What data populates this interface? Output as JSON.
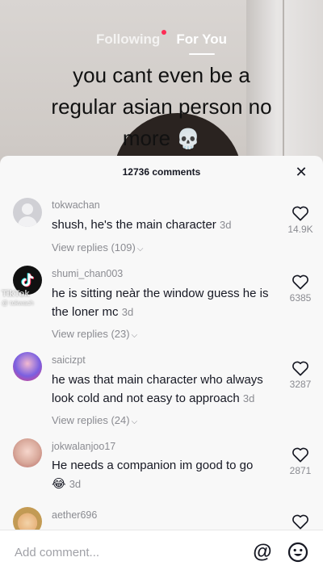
{
  "video": {
    "nav": {
      "following_label": "Following",
      "for_you_label": "For You"
    },
    "caption_lines": [
      "you cant even be a",
      "regular asian person no",
      "more"
    ],
    "caption_emoji": "💀"
  },
  "comments_sheet": {
    "title": "12736 comments",
    "close_icon": "close-icon",
    "comments": [
      {
        "username": "tokwachan",
        "text": "shush, he's the main character",
        "time": "3d",
        "replies": "View replies (109)",
        "likes": "14.9K",
        "avatar": "default-avatar"
      },
      {
        "username": "shumi_chan003",
        "text": "he is sitting neàr the window guess he is the loner mc",
        "time": "3d",
        "replies": "View replies (23)",
        "likes": "6385",
        "avatar": "tiktok-logo-avatar"
      },
      {
        "username": "saicizpt",
        "text": "he was that main character who always look cold and not easy to approach",
        "time": "3d",
        "replies": "View replies (24)",
        "likes": "3287",
        "avatar": "anime-avatar"
      },
      {
        "username": "jokwalanjoo17",
        "text": "He needs a companion im good to go",
        "emoji": "😂",
        "time": "3d",
        "likes": "2871",
        "avatar": "photo-avatar"
      },
      {
        "username": "aether696",
        "text": "",
        "time": "",
        "likes": "",
        "avatar": "straw-hat-avatar"
      }
    ],
    "watermark": {
      "brand": "TikTok",
      "handle": "@ tokwach"
    }
  },
  "input_bar": {
    "placeholder": "Add comment...",
    "value": "",
    "at_icon": "at-icon",
    "emoji_icon": "emoji-icon"
  },
  "colors": {
    "accent": "#fe2c55",
    "text": "#161823",
    "muted": "#8a8b91"
  }
}
